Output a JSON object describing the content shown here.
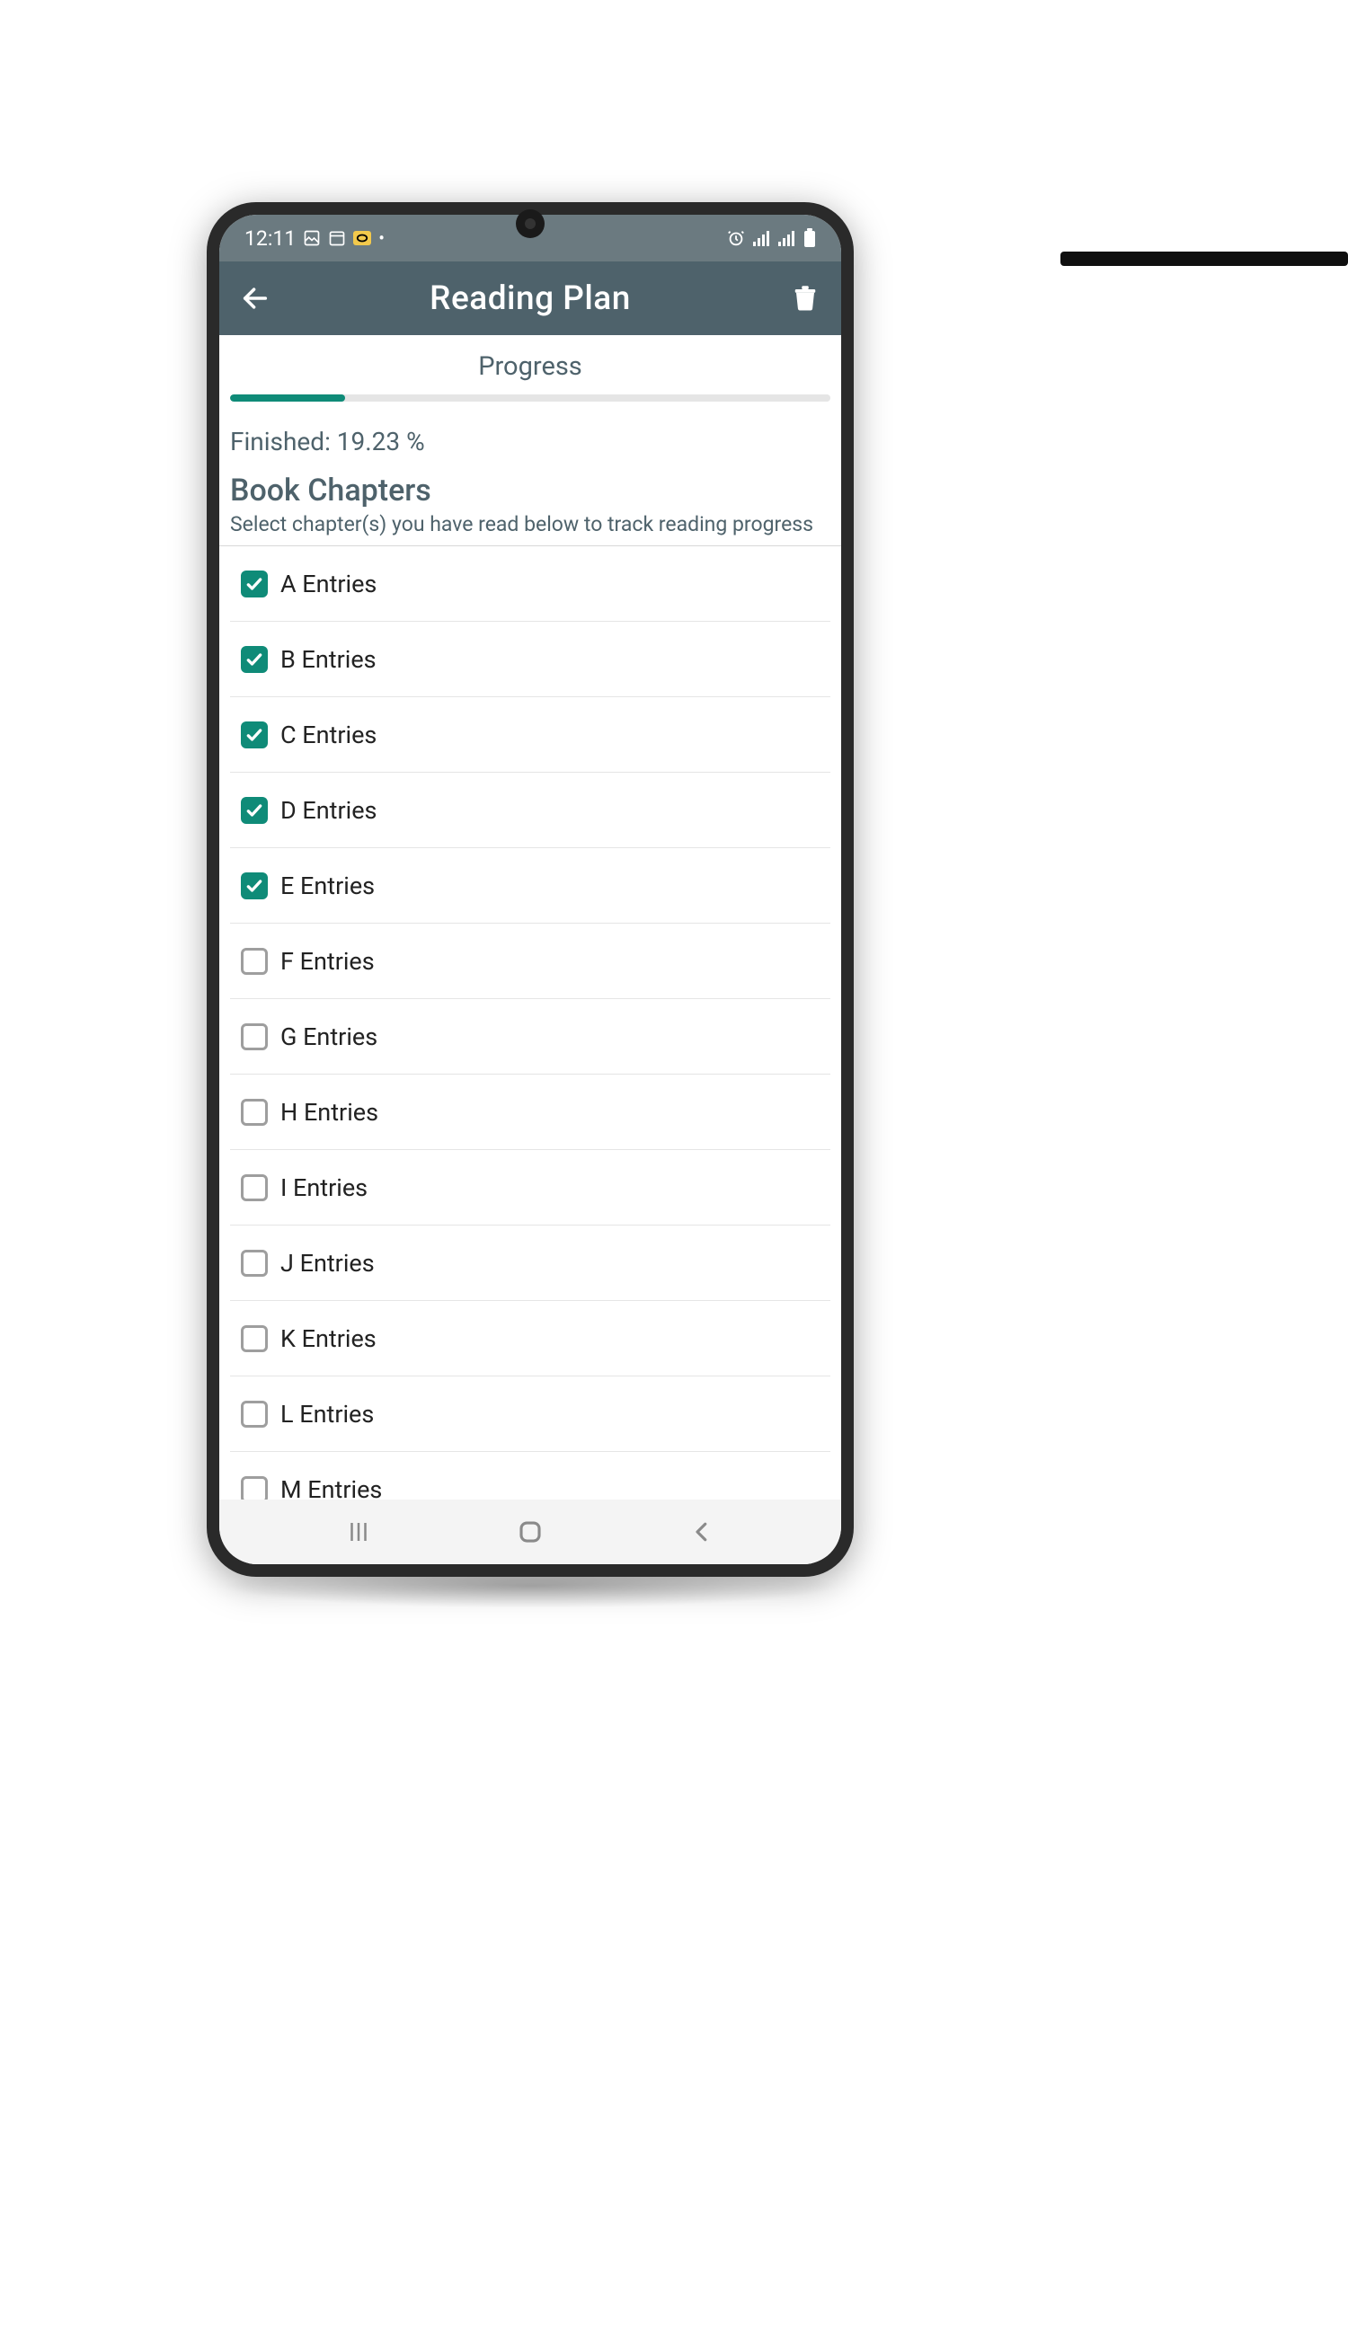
{
  "status": {
    "time": "12:11",
    "icons_left": [
      "image-icon",
      "calendar-icon",
      "sim-icon",
      "dot"
    ],
    "icons_right": [
      "alarm-icon",
      "signal-icon",
      "signal-icon",
      "battery-icon"
    ]
  },
  "appbar": {
    "title": "Reading Plan"
  },
  "progress": {
    "label": "Progress",
    "percent": 19.23,
    "finished_text": "Finished: 19.23 %"
  },
  "section": {
    "heading": "Book Chapters",
    "sub": "Select chapter(s) you have read below to track reading progress"
  },
  "chapters": [
    {
      "label": "A Entries",
      "checked": true
    },
    {
      "label": "B Entries",
      "checked": true
    },
    {
      "label": "C Entries",
      "checked": true
    },
    {
      "label": "D Entries",
      "checked": true
    },
    {
      "label": "E Entries",
      "checked": true
    },
    {
      "label": "F Entries",
      "checked": false
    },
    {
      "label": "G Entries",
      "checked": false
    },
    {
      "label": "H Entries",
      "checked": false
    },
    {
      "label": "I Entries",
      "checked": false
    },
    {
      "label": "J Entries",
      "checked": false
    },
    {
      "label": "K Entries",
      "checked": false
    },
    {
      "label": "L Entries",
      "checked": false
    },
    {
      "label": "M Entries",
      "checked": false
    }
  ],
  "colors": {
    "accent": "#0f8b78",
    "appbar": "#4e626b",
    "status": "#6b7a80"
  }
}
